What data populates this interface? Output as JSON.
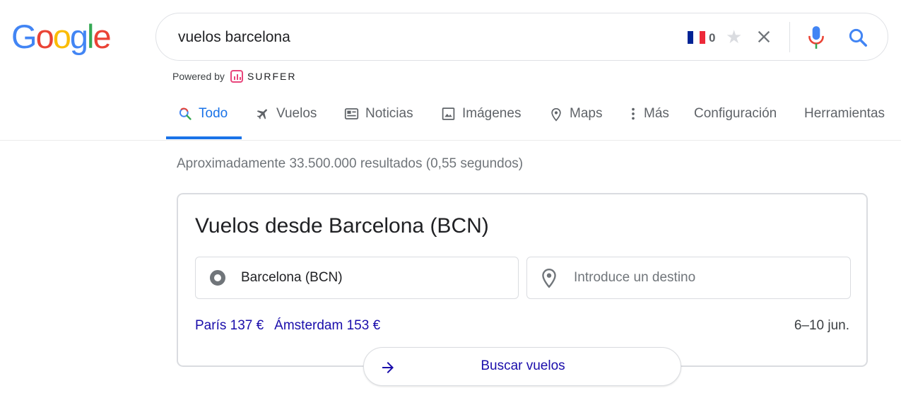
{
  "logo": {
    "letters": [
      "G",
      "o",
      "o",
      "g",
      "l",
      "e"
    ],
    "colors": [
      "#4285F4",
      "#EA4335",
      "#FBBC05",
      "#4285F4",
      "#34A853",
      "#EA4335"
    ]
  },
  "search": {
    "query": "vuelos barcelona",
    "flag_count": "0",
    "icons": [
      "flag-france-icon",
      "star-icon",
      "clear-icon",
      "mic-icon",
      "search-icon"
    ]
  },
  "powered": {
    "prefix": "Powered by",
    "brand": "SURFER",
    "brand_color": "#e8467c"
  },
  "tabs": [
    {
      "label": "Todo",
      "icon": "search-icon",
      "active": true
    },
    {
      "label": "Vuelos",
      "icon": "plane-icon"
    },
    {
      "label": "Noticias",
      "icon": "news-icon"
    },
    {
      "label": "Imágenes",
      "icon": "image-icon"
    },
    {
      "label": "Maps",
      "icon": "map-pin-icon"
    },
    {
      "label": "Más",
      "icon": "more-vertical-icon"
    },
    {
      "label": "Configuración"
    },
    {
      "label": "Herramientas"
    }
  ],
  "stats": "Aproximadamente 33.500.000 resultados (0,55 segundos)",
  "flights": {
    "title": "Vuelos desde Barcelona (BCN)",
    "origin": "Barcelona (BCN)",
    "destination_placeholder": "Introduce un destino",
    "deals": [
      "París 137 €",
      "Ámsterdam 153 €"
    ],
    "dates": "6–10 jun.",
    "button": "Buscar vuelos"
  },
  "colors": {
    "accent": "#1a73e8",
    "link": "#1a0dab",
    "muted": "#70757a"
  }
}
